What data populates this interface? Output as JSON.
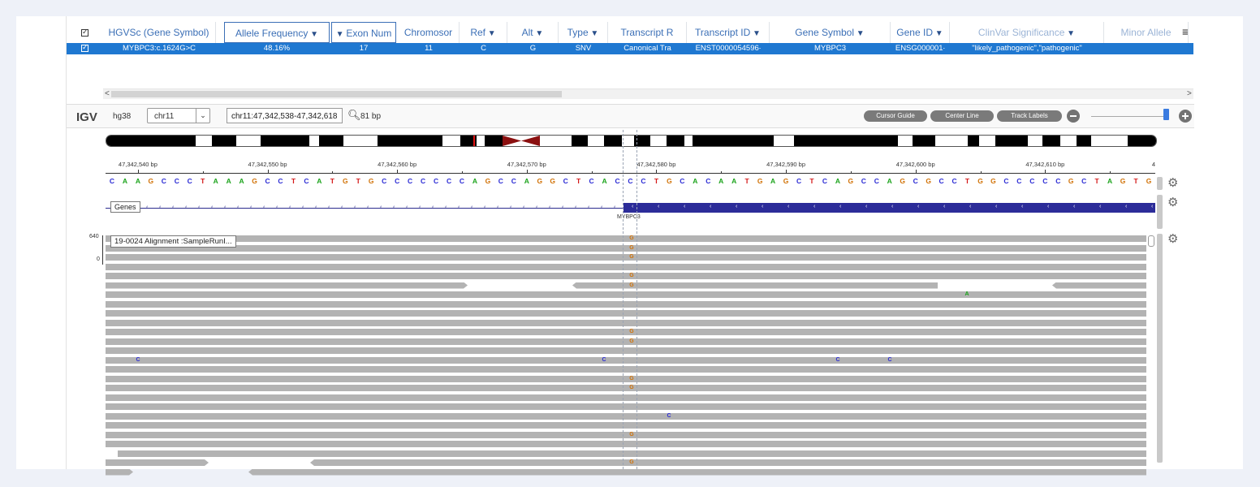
{
  "table": {
    "columns": [
      {
        "label": "HGVSc (Gene Symbol)",
        "filter": false
      },
      {
        "label": "Allele Frequency",
        "filter": true
      },
      {
        "label": "Exon Num",
        "filter": false,
        "sort": "▼"
      },
      {
        "label": "Chromosor",
        "filter": false
      },
      {
        "label": "Ref",
        "filter": true
      },
      {
        "label": "Alt",
        "filter": true
      },
      {
        "label": "Type",
        "filter": true
      },
      {
        "label": "Transcript R",
        "filter": false
      },
      {
        "label": "Transcript ID",
        "filter": true
      },
      {
        "label": "Gene Symbol",
        "filter": true
      },
      {
        "label": "Gene ID",
        "filter": true
      },
      {
        "label": "ClinVar Significance",
        "filter": true
      },
      {
        "label": "Minor Allele",
        "filter": false
      }
    ],
    "filter_icon": "▼",
    "selected_row": [
      "MYBPC3:c.1624G>C",
      "48.16%",
      "17",
      "11",
      "C",
      "G",
      "SNV",
      "Canonical Tra",
      "ENST0000054596·",
      "MYBPC3",
      "ENSG000001·",
      "\"likely_pathogenic\",\"pathogenic\"",
      ""
    ],
    "scroll_left": "<",
    "scroll_right": ">"
  },
  "igv": {
    "logo": "IGV",
    "genome": "hg38",
    "chromosome": "chr11",
    "locus": "chr11:47,342,538-47,342,618",
    "width_label": "81 bp",
    "buttons": [
      "Cursor Guide",
      "Center Line",
      "Track Labels"
    ],
    "zoom_level": 0.98
  },
  "ruler": {
    "labels": [
      "47,342,540 bp",
      "47,342,550 bp",
      "47,342,560 bp",
      "47,342,570 bp",
      "47,342,580 bp",
      "47,342,590 bp",
      "47,342,600 bp",
      "47,342,610 bp"
    ],
    "edge_label": "4"
  },
  "sequence": "CAAGCCCTAAAGCCTCATGTGCCCCCCCAGCCAGGCTCACCCTGCACAATGAGCTCAGCCAGCGCCTGGCCCCCGCTAGTG",
  "base_colors": {
    "A": "#1aa31a",
    "C": "#2a2ad4",
    "G": "#d17105",
    "T": "#d41818"
  },
  "genes_track": {
    "label": "Genes",
    "gene": "MYBPC3"
  },
  "alignment_track": {
    "label": "19-0024 Alignment :SampleRunI...",
    "coverage_max": "640",
    "coverage_min": "0",
    "mismatch_G": "G",
    "mismatch_A": "A",
    "mismatch_C": "C"
  },
  "colors": {
    "selected_row": "#1f78d1",
    "header_text": "#3b6fb6",
    "read": "#b3b3b3",
    "gene": "#2c2c99"
  }
}
